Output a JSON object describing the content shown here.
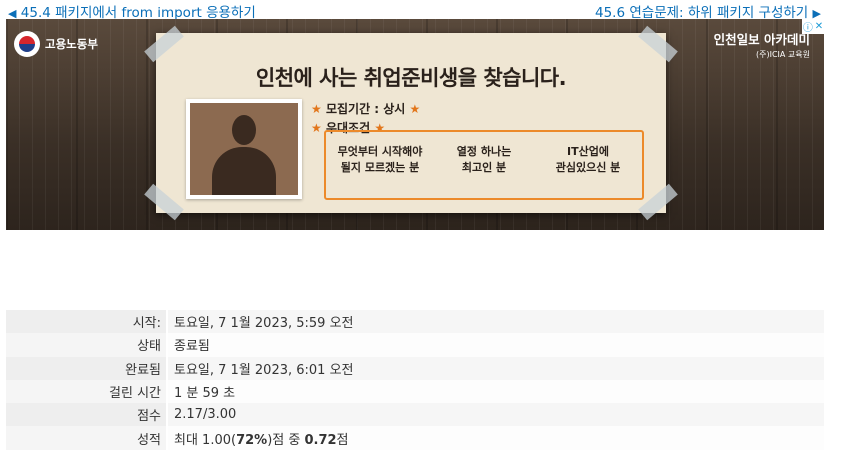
{
  "nav": {
    "prev_label": "45.4 패키지에서 from import 응용하기",
    "next_label": "45.6 연습문제: 하위 패키지 구성하기",
    "prev_arrow": "◀",
    "next_arrow": "▶"
  },
  "ad": {
    "ministry": "고용노동부",
    "academy": "인천일보 아카데미",
    "academy_sub": "(주)ICIA 교육원",
    "adchoices_i": "ⓘ",
    "adchoices_x": "✕",
    "headline": "인천에 사는 취업준비생을 찾습니다.",
    "period_label": "모집기간 : 상시",
    "preference_label": "우대조건",
    "star": "★",
    "preferences": [
      {
        "line1": "무엇부터 시작해야",
        "line2": "될지 모르겠는 분"
      },
      {
        "line1": "열정 하나는",
        "line2": "최고인 분"
      },
      {
        "line1": "IT산업에",
        "line2": "관심있으신 분"
      }
    ]
  },
  "summary": {
    "rows": [
      {
        "label": "시작:",
        "value": "토요일, 7 1월 2023, 5:59 오전"
      },
      {
        "label": "상태",
        "value": "종료됨"
      },
      {
        "label": "완료됨",
        "value": "토요일, 7 1월 2023, 6:01 오전"
      },
      {
        "label": "걸린 시간",
        "value": "1 분 59 초"
      },
      {
        "label": "점수",
        "value": "2.17/3.00"
      }
    ],
    "grade": {
      "label": "성적",
      "prefix": "최대 1.00(",
      "percent": "72%",
      "middle": ")점 중 ",
      "score": "0.72",
      "suffix": "점"
    }
  }
}
